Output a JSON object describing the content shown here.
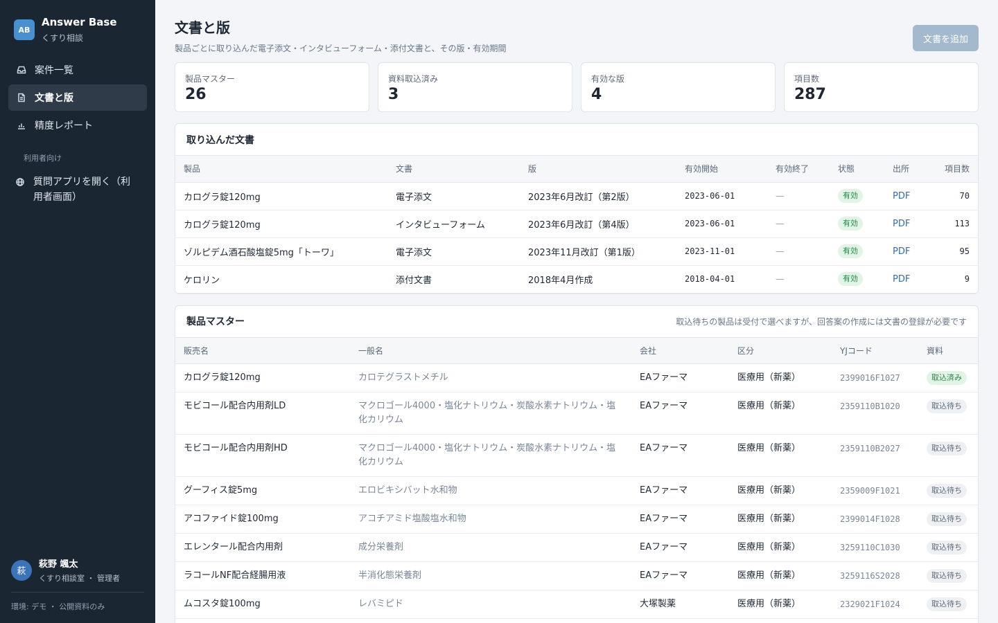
{
  "brand": {
    "logo": "AB",
    "title": "Answer Base",
    "subtitle": "くすり相談"
  },
  "nav": {
    "items": [
      {
        "label": "案件一覧",
        "icon": "inbox-icon"
      },
      {
        "label": "文書と版",
        "icon": "document-icon"
      },
      {
        "label": "精度レポート",
        "icon": "bar-chart-icon"
      }
    ],
    "section_label": "利用者向け",
    "user_app": {
      "label": "質問アプリを開く（利用者画面）",
      "icon": "globe-icon"
    }
  },
  "user": {
    "avatar": "萩",
    "name": "萩野 颯太",
    "role": "くすり相談室 ・ 管理者"
  },
  "env": "環境: デモ ・ 公開資料のみ",
  "page": {
    "title": "文書と版",
    "subtitle": "製品ごとに取り込んだ電子添文・インタビューフォーム・添付文書と、その版・有効期間",
    "add_button": "文書を追加"
  },
  "stats": [
    {
      "label": "製品マスター",
      "value": "26"
    },
    {
      "label": "資料取込済み",
      "value": "3"
    },
    {
      "label": "有効な版",
      "value": "4"
    },
    {
      "label": "項目数",
      "value": "287"
    }
  ],
  "documents": {
    "title": "取り込んだ文書",
    "columns": [
      "製品",
      "文書",
      "版",
      "有効開始",
      "有効終了",
      "状態",
      "出所",
      "項目数"
    ],
    "rows": [
      {
        "product": "カログラ錠120mg",
        "doc": "電子添文",
        "version": "2023年6月改訂（第2版）",
        "start": "2023-06-01",
        "end": "—",
        "status": "有効",
        "source": "PDF",
        "count": "70"
      },
      {
        "product": "カログラ錠120mg",
        "doc": "インタビューフォーム",
        "version": "2023年6月改訂（第4版）",
        "start": "2023-06-01",
        "end": "—",
        "status": "有効",
        "source": "PDF",
        "count": "113"
      },
      {
        "product": "ゾルピデム酒石酸塩錠5mg「トーワ」",
        "doc": "電子添文",
        "version": "2023年11月改訂（第1版）",
        "start": "2023-11-01",
        "end": "—",
        "status": "有効",
        "source": "PDF",
        "count": "95"
      },
      {
        "product": "ケロリン",
        "doc": "添付文書",
        "version": "2018年4月作成",
        "start": "2018-04-01",
        "end": "—",
        "status": "有効",
        "source": "PDF",
        "count": "9"
      }
    ]
  },
  "products": {
    "title": "製品マスター",
    "note": "取込待ちの製品は受付で選べますが、回答案の作成には文書の登録が必要です",
    "columns": [
      "販売名",
      "一般名",
      "会社",
      "区分",
      "YJコード",
      "資料"
    ],
    "rows": [
      {
        "name": "カログラ錠120mg",
        "generic": "カロテグラストメチル",
        "company": "EAファーマ",
        "category": "医療用（新薬）",
        "yj": "2399016F1027",
        "status": "取込済み",
        "done": true
      },
      {
        "name": "モビコール配合内用剤LD",
        "generic": "マクロゴール4000・塩化ナトリウム・炭酸水素ナトリウム・塩化カリウム",
        "company": "EAファーマ",
        "category": "医療用（新薬）",
        "yj": "2359110B1020",
        "status": "取込待ち",
        "done": false
      },
      {
        "name": "モビコール配合内用剤HD",
        "generic": "マクロゴール4000・塩化ナトリウム・炭酸水素ナトリウム・塩化カリウム",
        "company": "EAファーマ",
        "category": "医療用（新薬）",
        "yj": "2359110B2027",
        "status": "取込待ち",
        "done": false
      },
      {
        "name": "グーフィス錠5mg",
        "generic": "エロビキシバット水和物",
        "company": "EAファーマ",
        "category": "医療用（新薬）",
        "yj": "2359009F1021",
        "status": "取込待ち",
        "done": false
      },
      {
        "name": "アコファイド錠100mg",
        "generic": "アコチアミド塩酸塩水和物",
        "company": "EAファーマ",
        "category": "医療用（新薬）",
        "yj": "2399014F1028",
        "status": "取込待ち",
        "done": false
      },
      {
        "name": "エレンタール配合内用剤",
        "generic": "成分栄養剤",
        "company": "EAファーマ",
        "category": "医療用（新薬）",
        "yj": "3259110C1030",
        "status": "取込待ち",
        "done": false
      },
      {
        "name": "ラコールNF配合経腸用液",
        "generic": "半消化態栄養剤",
        "company": "EAファーマ",
        "category": "医療用（新薬）",
        "yj": "3259116S2028",
        "status": "取込待ち",
        "done": false
      },
      {
        "name": "ムコスタ錠100mg",
        "generic": "レバミピド",
        "company": "大塚製薬",
        "category": "医療用（新薬）",
        "yj": "2329021F1024",
        "status": "取込待ち",
        "done": false
      },
      {
        "name": "",
        "generic": "",
        "company": "",
        "category": "",
        "yj": "",
        "status": "",
        "done": false
      }
    ]
  },
  "colors": {
    "sidebar": "#1b2633",
    "accent": "#4a8fd0",
    "ok": "#2f8049",
    "link": "#2f6cb1"
  }
}
